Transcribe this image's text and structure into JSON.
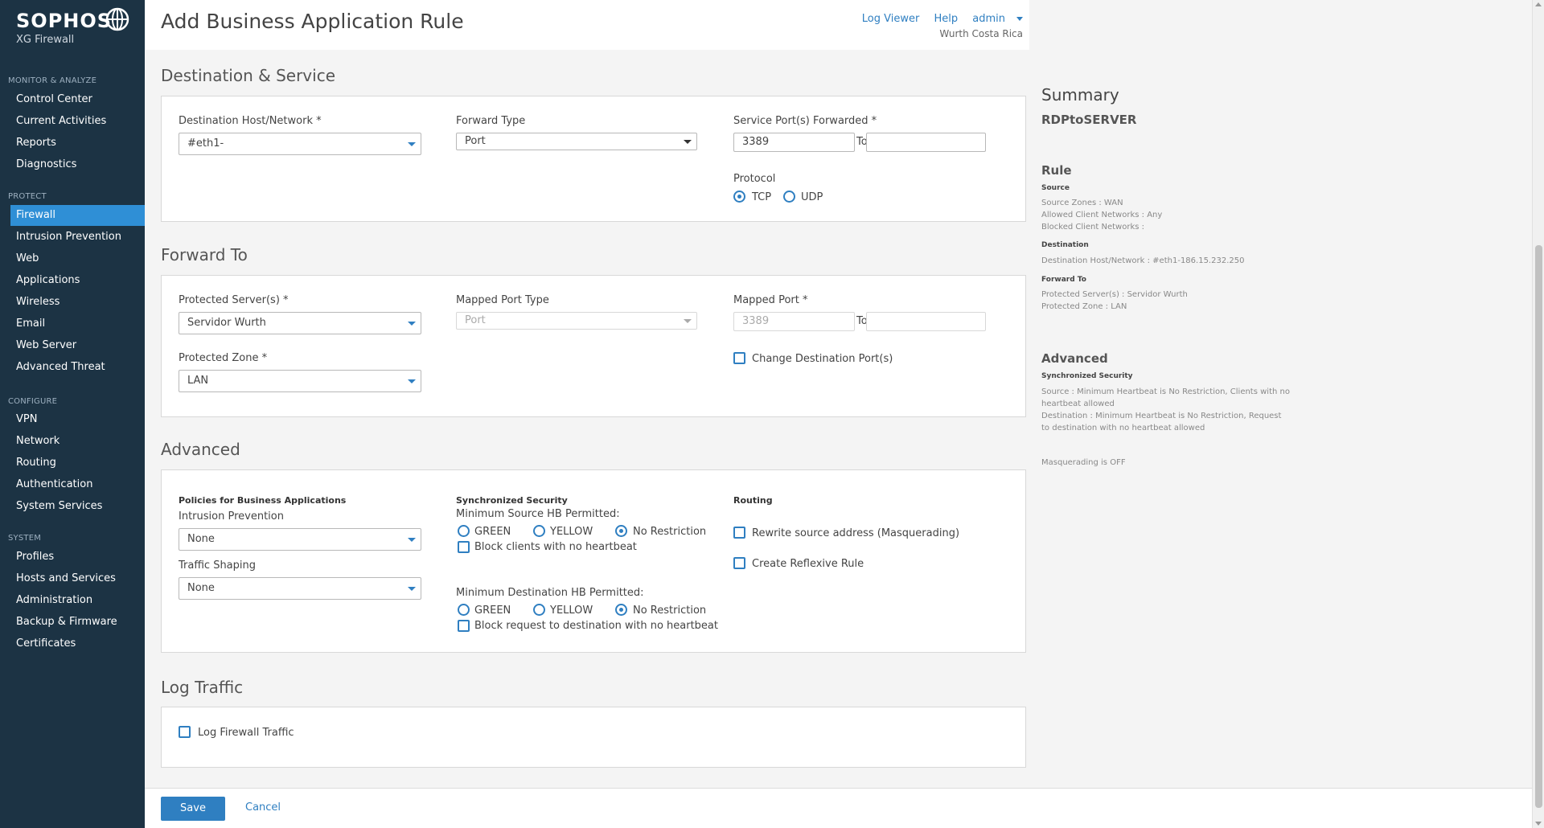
{
  "brand": {
    "name": "SOPHOS",
    "product": "XG Firewall"
  },
  "sidebar": {
    "sections": [
      {
        "title": "MONITOR & ANALYZE",
        "items": [
          "Control Center",
          "Current Activities",
          "Reports",
          "Diagnostics"
        ]
      },
      {
        "title": "PROTECT",
        "items": [
          "Firewall",
          "Intrusion Prevention",
          "Web",
          "Applications",
          "Wireless",
          "Email",
          "Web Server",
          "Advanced Threat"
        ]
      },
      {
        "title": "CONFIGURE",
        "items": [
          "VPN",
          "Network",
          "Routing",
          "Authentication",
          "System Services"
        ]
      },
      {
        "title": "SYSTEM",
        "items": [
          "Profiles",
          "Hosts and Services",
          "Administration",
          "Backup & Firmware",
          "Certificates"
        ]
      }
    ],
    "active": "Firewall"
  },
  "header": {
    "title": "Add Business Application Rule",
    "log_viewer": "Log Viewer",
    "help": "Help",
    "user": "admin",
    "org": "Wurth Costa Rica"
  },
  "destination": {
    "section_title": "Destination & Service",
    "dest_host_label": "Destination Host/Network *",
    "dest_host_value": "#eth1-",
    "forward_type_label": "Forward Type",
    "forward_type_value": "Port",
    "service_port_label": "Service Port(s) Forwarded *",
    "service_port_value": "3389",
    "service_port_to_value": "",
    "to_label": "To",
    "protocol_label": "Protocol",
    "protocol_tcp": "TCP",
    "protocol_udp": "UDP"
  },
  "forward_to": {
    "section_title": "Forward To",
    "protected_server_label": "Protected Server(s) *",
    "protected_server_value": "Servidor Wurth",
    "mapped_port_type_label": "Mapped Port Type",
    "mapped_port_type_value": "Port",
    "mapped_port_label": "Mapped Port *",
    "mapped_port_value": "3389",
    "to_label": "To",
    "protected_zone_label": "Protected Zone *",
    "protected_zone_value": "LAN",
    "change_dest_port_label": "Change Destination Port(s)"
  },
  "advanced": {
    "section_title": "Advanced",
    "policies_title": "Policies for Business Applications",
    "ips_label": "Intrusion Prevention",
    "ips_value": "None",
    "traffic_shaping_label": "Traffic Shaping",
    "traffic_shaping_value": "None",
    "sync_title": "Synchronized Security",
    "min_source_label": "Minimum Source HB Permitted:",
    "green": "GREEN",
    "yellow": "YELLOW",
    "no_restriction": "No Restriction",
    "block_clients_label": "Block clients with no heartbeat",
    "min_dest_label": "Minimum Destination HB Permitted:",
    "block_request_label": "Block request to destination with no heartbeat",
    "routing_title": "Routing",
    "rewrite_label": "Rewrite source address (Masquerading)",
    "reflexive_label": "Create Reflexive Rule"
  },
  "log_traffic": {
    "section_title": "Log Traffic",
    "log_firewall_label": "Log Firewall Traffic"
  },
  "summary": {
    "title": "Summary",
    "rule_name": "RDPtoSERVER",
    "rule_heading": "Rule",
    "source_heading": "Source",
    "source_zones": "Source Zones : WAN",
    "allowed_clients": "Allowed Client Networks : Any",
    "blocked_clients": "Blocked Client Networks :",
    "destination_heading": "Destination",
    "dest_host": "Destination Host/Network : #eth1-186.15.232.250",
    "forward_heading": "Forward To",
    "protected_servers": "Protected Server(s) : Servidor Wurth",
    "protected_zone": "Protected Zone : LAN",
    "advanced_heading": "Advanced",
    "sync_heading": "Synchronized Security",
    "sync_line1": "Source : Minimum Heartbeat is No Restriction, Clients with no",
    "sync_line2": "heartbeat allowed",
    "sync_line3": "Destination : Minimum Heartbeat is No Restriction, Request",
    "sync_line4": "to destination with no heartbeat allowed",
    "masquerading": "Masquerading is OFF"
  },
  "footer": {
    "save": "Save",
    "cancel": "Cancel"
  },
  "colors": {
    "sidebar_bg": "#1c3344",
    "active_item": "#2f8fd6",
    "accent": "#2f7fc1"
  }
}
